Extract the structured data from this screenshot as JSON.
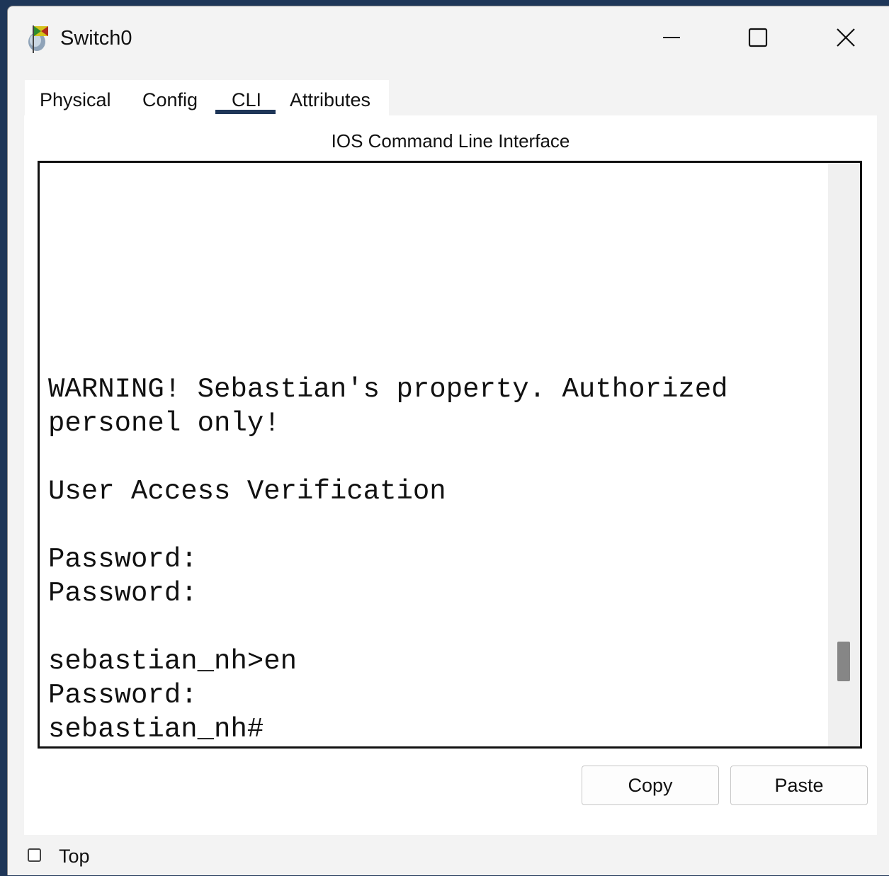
{
  "window": {
    "title": "Switch0",
    "icon": "switch-device-icon",
    "controls": {
      "minimize": "minimize-icon",
      "maximize": "maximize-icon",
      "close": "close-icon"
    }
  },
  "tabs": [
    {
      "label": "Physical",
      "active": false
    },
    {
      "label": "Config",
      "active": false
    },
    {
      "label": "CLI",
      "active": true
    },
    {
      "label": "Attributes",
      "active": false
    }
  ],
  "panel": {
    "title": "IOS Command Line Interface"
  },
  "terminal": {
    "lines": [
      "WARNING! Sebastian's property. Authorized",
      "personel only!",
      "",
      "User Access Verification",
      "",
      "Password:",
      "Password:",
      "",
      "sebastian_nh>en",
      "Password:",
      "sebastian_nh#"
    ],
    "scroll_position": 0.88
  },
  "buttons": {
    "copy": "Copy",
    "paste": "Paste"
  },
  "footer": {
    "top_label": "Top",
    "top_checked": false
  },
  "colors": {
    "accent": "#1e3658",
    "background": "#f3f3f3",
    "panel": "#ffffff"
  }
}
